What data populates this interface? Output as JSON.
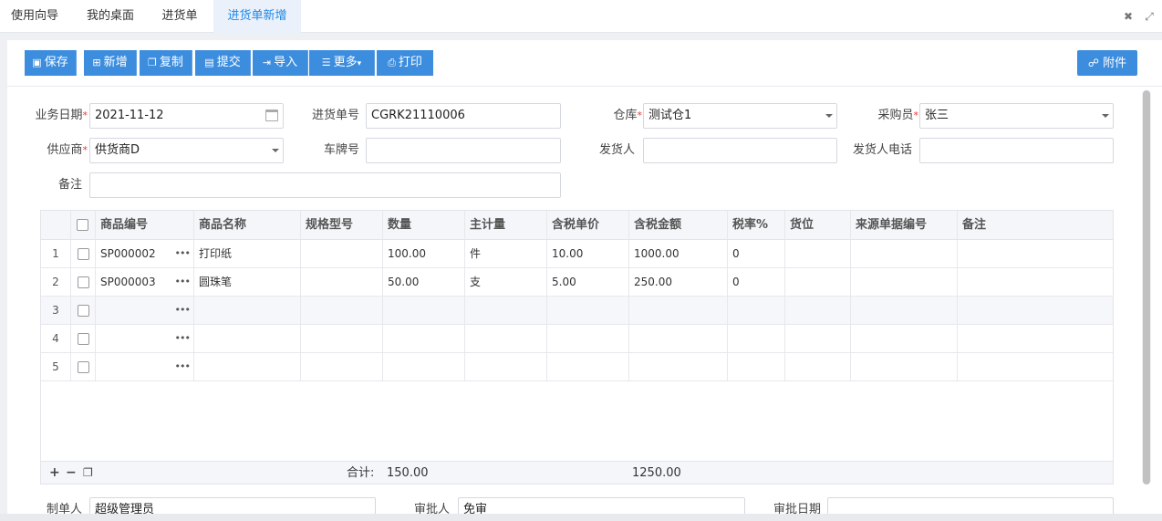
{
  "tabs": [
    {
      "label": "使用向导"
    },
    {
      "label": "我的桌面"
    },
    {
      "label": "进货单"
    },
    {
      "label": "进货单新增"
    }
  ],
  "toolbar": {
    "save": "保存",
    "add": "新增",
    "copy": "复制",
    "submit": "提交",
    "import": "导入",
    "more": "更多",
    "print": "打印",
    "attach": "附件"
  },
  "form": {
    "biz_date_label": "业务日期",
    "biz_date": "2021-11-12",
    "order_no_label": "进货单号",
    "order_no": "CGRK21110006",
    "warehouse_label": "仓库",
    "warehouse": "测试仓1",
    "buyer_label": "采购员",
    "buyer": "张三",
    "supplier_label": "供应商",
    "supplier": "供货商D",
    "plate_label": "车牌号",
    "plate": "",
    "shipper_label": "发货人",
    "shipper": "",
    "shipper_phone_label": "发货人电话",
    "shipper_phone": "",
    "remark_label": "备注",
    "remark": ""
  },
  "grid": {
    "headers": [
      "商品编号",
      "商品名称",
      "规格型号",
      "数量",
      "主计量",
      "含税单价",
      "含税金额",
      "税率%",
      "货位",
      "来源单据编号",
      "备注"
    ],
    "rows": [
      {
        "no": "1",
        "code": "SP000002",
        "name": "打印纸",
        "spec": "",
        "qty": "100.00",
        "unit": "件",
        "price": "10.00",
        "amount": "1000.00",
        "tax": "0",
        "loc": "",
        "src": "",
        "remark": ""
      },
      {
        "no": "2",
        "code": "SP000003",
        "name": "圆珠笔",
        "spec": "",
        "qty": "50.00",
        "unit": "支",
        "price": "5.00",
        "amount": "250.00",
        "tax": "0",
        "loc": "",
        "src": "",
        "remark": ""
      },
      {
        "no": "3",
        "code": "",
        "name": "",
        "spec": "",
        "qty": "",
        "unit": "",
        "price": "",
        "amount": "",
        "tax": "",
        "loc": "",
        "src": "",
        "remark": ""
      },
      {
        "no": "4",
        "code": "",
        "name": "",
        "spec": "",
        "qty": "",
        "unit": "",
        "price": "",
        "amount": "",
        "tax": "",
        "loc": "",
        "src": "",
        "remark": ""
      },
      {
        "no": "5",
        "code": "",
        "name": "",
        "spec": "",
        "qty": "",
        "unit": "",
        "price": "",
        "amount": "",
        "tax": "",
        "loc": "",
        "src": "",
        "remark": ""
      }
    ],
    "total_label": "合计:",
    "total_qty": "150.00",
    "total_amount": "1250.00"
  },
  "footer": {
    "creator_label": "制单人",
    "creator": "超级管理员",
    "approver_label": "审批人",
    "approver": "免审",
    "approve_date_label": "审批日期",
    "approve_date": ""
  },
  "colors": {
    "accent": "#3c8dde",
    "active_tab_text": "#1e88e5",
    "required": "#e53935"
  }
}
